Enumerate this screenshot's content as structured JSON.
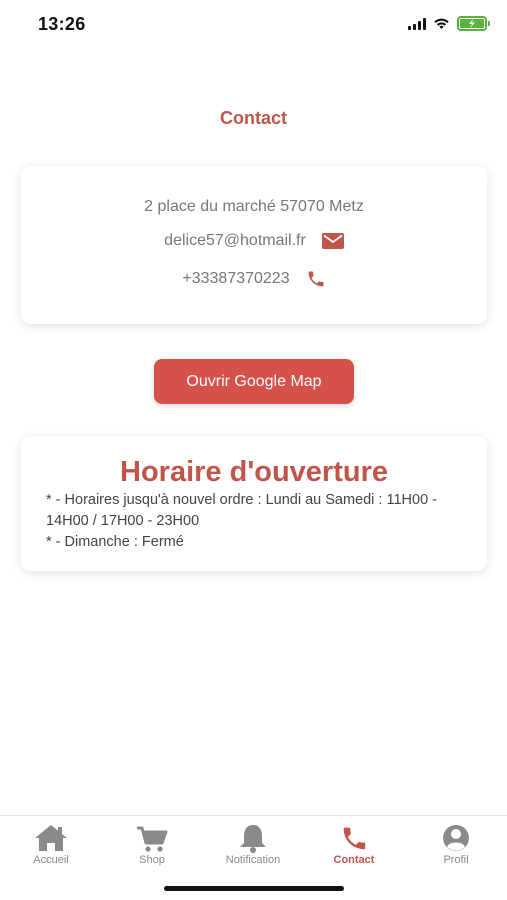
{
  "status_bar": {
    "time": "13:26"
  },
  "page": {
    "title": "Contact"
  },
  "contact": {
    "address": "2 place du marché 57070 Metz",
    "email": "delice57@hotmail.fr",
    "phone": "+33387370223"
  },
  "map_button": {
    "label": "Ouvrir Google Map"
  },
  "hours": {
    "title": "Horaire d'ouverture",
    "line1": "* - Horaires jusqu'à nouvel ordre : Lundi au Samedi : 11H00 - 14H00 / 17H00 - 23H00",
    "line2": "* - Dimanche : Fermé"
  },
  "tabs": [
    {
      "label": "Accueil",
      "icon": "home-icon"
    },
    {
      "label": "Shop",
      "icon": "cart-icon"
    },
    {
      "label": "Notification",
      "icon": "bell-icon"
    },
    {
      "label": "Contact",
      "icon": "phone-icon",
      "active": true
    },
    {
      "label": "Profil",
      "icon": "user-icon"
    }
  ],
  "colors": {
    "accent": "#c0564b",
    "button": "#d4524a",
    "tab_inactive": "#888888",
    "battery": "#58b33b"
  }
}
